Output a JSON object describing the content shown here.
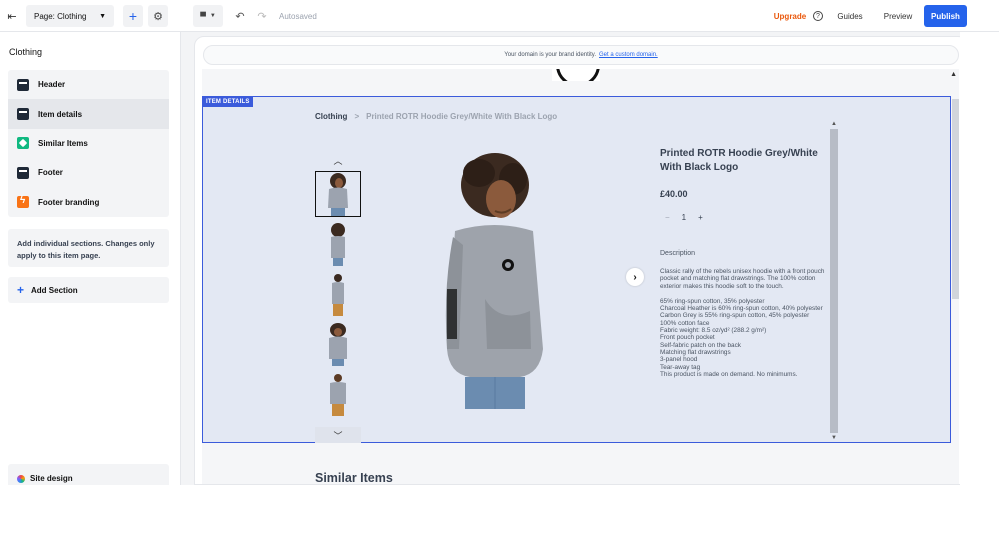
{
  "topbar": {
    "page_select_label": "Page: Clothing",
    "autosaved": "Autosaved",
    "upgrade": "Upgrade",
    "help": "?",
    "guides": "Guides",
    "preview": "Preview",
    "publish": "Publish"
  },
  "sidebar": {
    "title": "Clothing",
    "sections": [
      {
        "label": "Header",
        "icon": "header-icon"
      },
      {
        "label": "Item details",
        "icon": "item-details-icon"
      },
      {
        "label": "Similar Items",
        "icon": "similar-items-icon"
      },
      {
        "label": "Footer",
        "icon": "footer-icon"
      },
      {
        "label": "Footer branding",
        "icon": "footer-branding-icon"
      }
    ],
    "note": "Add individual sections. Changes only apply to this item page.",
    "add_section": "Add Section",
    "site_design": "Site design"
  },
  "canvas": {
    "domain_text": "Your domain is your brand identity.",
    "domain_link": "Get a custom domain.",
    "section_badge": "ITEM DETAILS",
    "breadcrumb": {
      "home": "Clothing",
      "separator": ">",
      "current": "Printed ROTR Hoodie Grey/White With Black Logo"
    },
    "product": {
      "title": "Printed ROTR Hoodie Grey/White With Black Logo",
      "price": "£40.00",
      "quantity": "1",
      "description_label": "Description",
      "description": "Classic rally of the rebels unisex hoodie with a front pouch pocket and matching flat drawstrings. The 100% cotton exterior makes this hoodie soft to the touch.",
      "specs": [
        "65% ring-spun cotton, 35% polyester",
        "Charcoal Heather is 60% ring-spun cotton, 40% polyester",
        "Carbon Grey is 55% ring-spun cotton, 45% polyester",
        "100% cotton face",
        "Fabric weight: 8.5 oz/yd² (288.2 g/m²)",
        "Front pouch pocket",
        "Self-fabric patch on the back",
        "Matching flat drawstrings",
        "3-panel hood",
        "Tear-away tag",
        "This product is made on demand. No minimums."
      ]
    },
    "similar_title": "Similar Items"
  }
}
